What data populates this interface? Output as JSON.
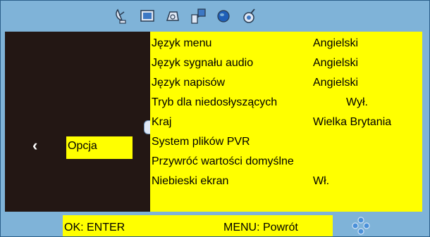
{
  "toolbar": {
    "icons": [
      "satellite-dish-icon",
      "screen-icon",
      "speaker-icon",
      "network-icon",
      "globe-icon",
      "settings-icon"
    ]
  },
  "left": {
    "back_glyph": "‹",
    "section_label": "Opcja"
  },
  "menu": {
    "items": [
      {
        "label": "Język menu",
        "value": "Angielski"
      },
      {
        "label": "Język sygnału audio",
        "value": "Angielski"
      },
      {
        "label": "Język napisów",
        "value": "Angielski"
      },
      {
        "label": "Tryb dla niedosłyszących",
        "value": "Wył."
      },
      {
        "label": "Kraj",
        "value": "Wielka Brytania"
      },
      {
        "label": "System plików PVR",
        "value": ""
      },
      {
        "label": "Przywróć wartości domyślne",
        "value": ""
      },
      {
        "label": "Niebieski ekran",
        "value": "Wł."
      }
    ]
  },
  "footer": {
    "ok_hint": "OK: ENTER",
    "menu_hint": "MENU: Powrót"
  },
  "colors": {
    "background": "#7fb3d8",
    "highlight": "#ffff00",
    "panel_dark": "#231714"
  }
}
